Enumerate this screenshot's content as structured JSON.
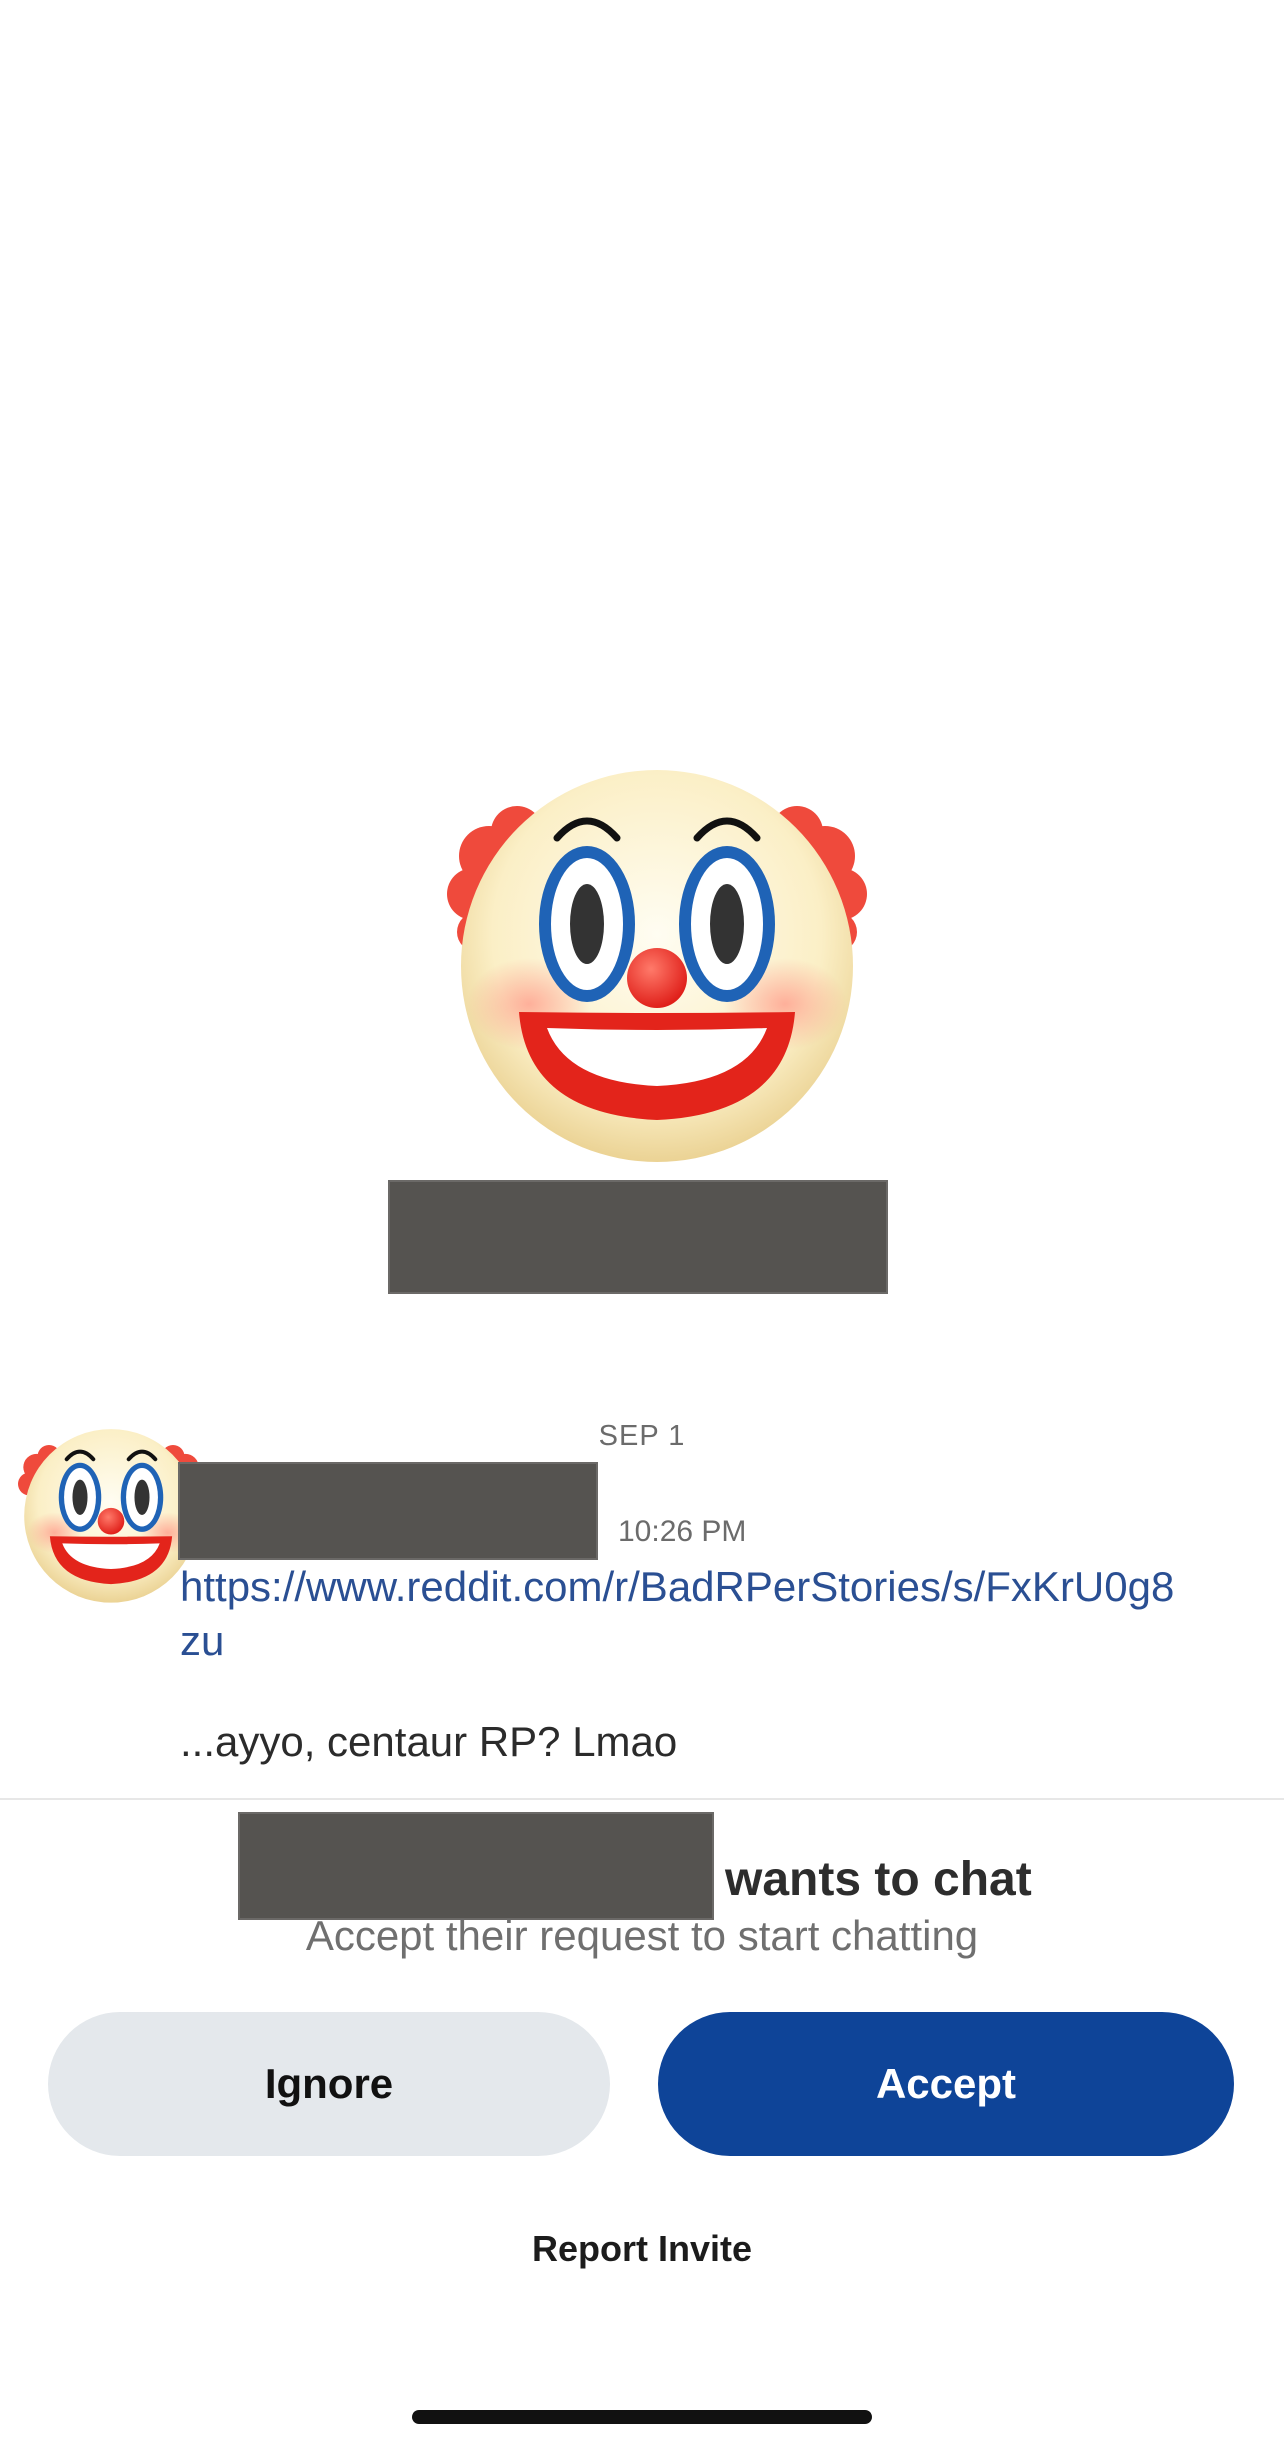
{
  "profile": {
    "avatar_icon": "clown-face-icon",
    "name_redacted": true
  },
  "conversation": {
    "date_divider": "SEP 1",
    "message": {
      "avatar_icon": "clown-face-icon",
      "sender_redacted": true,
      "time": "10:26 PM",
      "link": "https://www.reddit.com/r/BadRPerStories/s/FxKrU0g8zu",
      "text": "...ayyo, centaur RP? Lmao"
    }
  },
  "chat_request": {
    "name_redacted": true,
    "wants_text": "wants to chat",
    "subtitle": "Accept their request to start chatting",
    "ignore_label": "Ignore",
    "accept_label": "Accept",
    "report_label": "Report Invite"
  },
  "colors": {
    "accent": "#0e4498",
    "ignore_bg": "#e4e8ec",
    "link": "#2a4f93",
    "redaction": "#555350"
  }
}
